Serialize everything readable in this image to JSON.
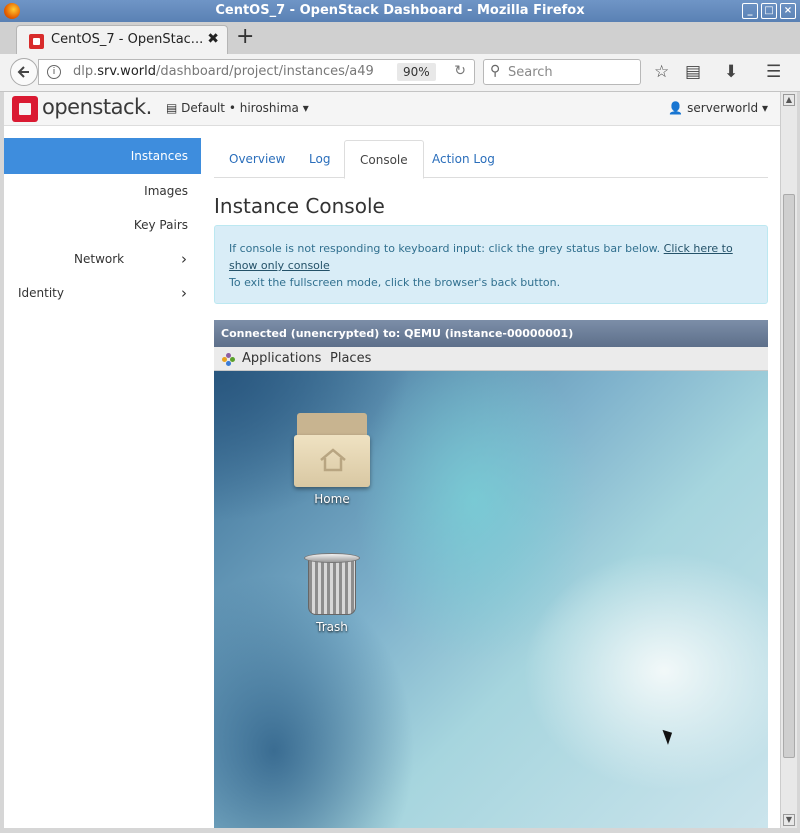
{
  "window": {
    "title": "CentOS_7 - OpenStack Dashboard - Mozilla Firefox",
    "icon": "firefox-icon",
    "buttons": [
      "minimize-icon",
      "maximize-icon",
      "close-icon"
    ]
  },
  "browser": {
    "tab_title": "CentOS_7 - OpenStac...",
    "tab_close": "✖",
    "new_tab": "+",
    "url_prefix": "dlp.",
    "url_domain": "srv.world",
    "url_path": "/dashboard/project/instances/a49",
    "zoom": "90%",
    "search_placeholder": "Search"
  },
  "header": {
    "logo_text": "openstack.",
    "project_selector": "Default • hiroshima",
    "user_menu": "serverworld"
  },
  "sidebar": {
    "items": [
      {
        "label": "Instances",
        "active": true
      },
      {
        "label": "Images"
      },
      {
        "label": "Key Pairs"
      },
      {
        "label": "Network",
        "chevron": "›"
      },
      {
        "label": "Identity",
        "chevron": "›"
      }
    ]
  },
  "main": {
    "tabs": [
      "Overview",
      "Log",
      "Console",
      "Action Log"
    ],
    "active_tab": "Console",
    "heading": "Instance Console",
    "alert": {
      "line1": "If console is not responding to keyboard input: click the grey status bar below.",
      "link": "Click here to show only console",
      "line2": "To exit the fullscreen mode, click the browser's back button."
    }
  },
  "console": {
    "status": "Connected (unencrypted) to: QEMU (instance-00000001)",
    "menu": [
      "Applications",
      "Places"
    ],
    "desktop_icons": [
      {
        "label": "Home",
        "icon": "home-folder-icon"
      },
      {
        "label": "Trash",
        "icon": "trash-icon"
      }
    ]
  },
  "colors": {
    "sidebar_active": "#3e8ddd",
    "link": "#2a6ebb",
    "alert_bg": "#d9edf7",
    "brand_red": "#da1a32"
  }
}
